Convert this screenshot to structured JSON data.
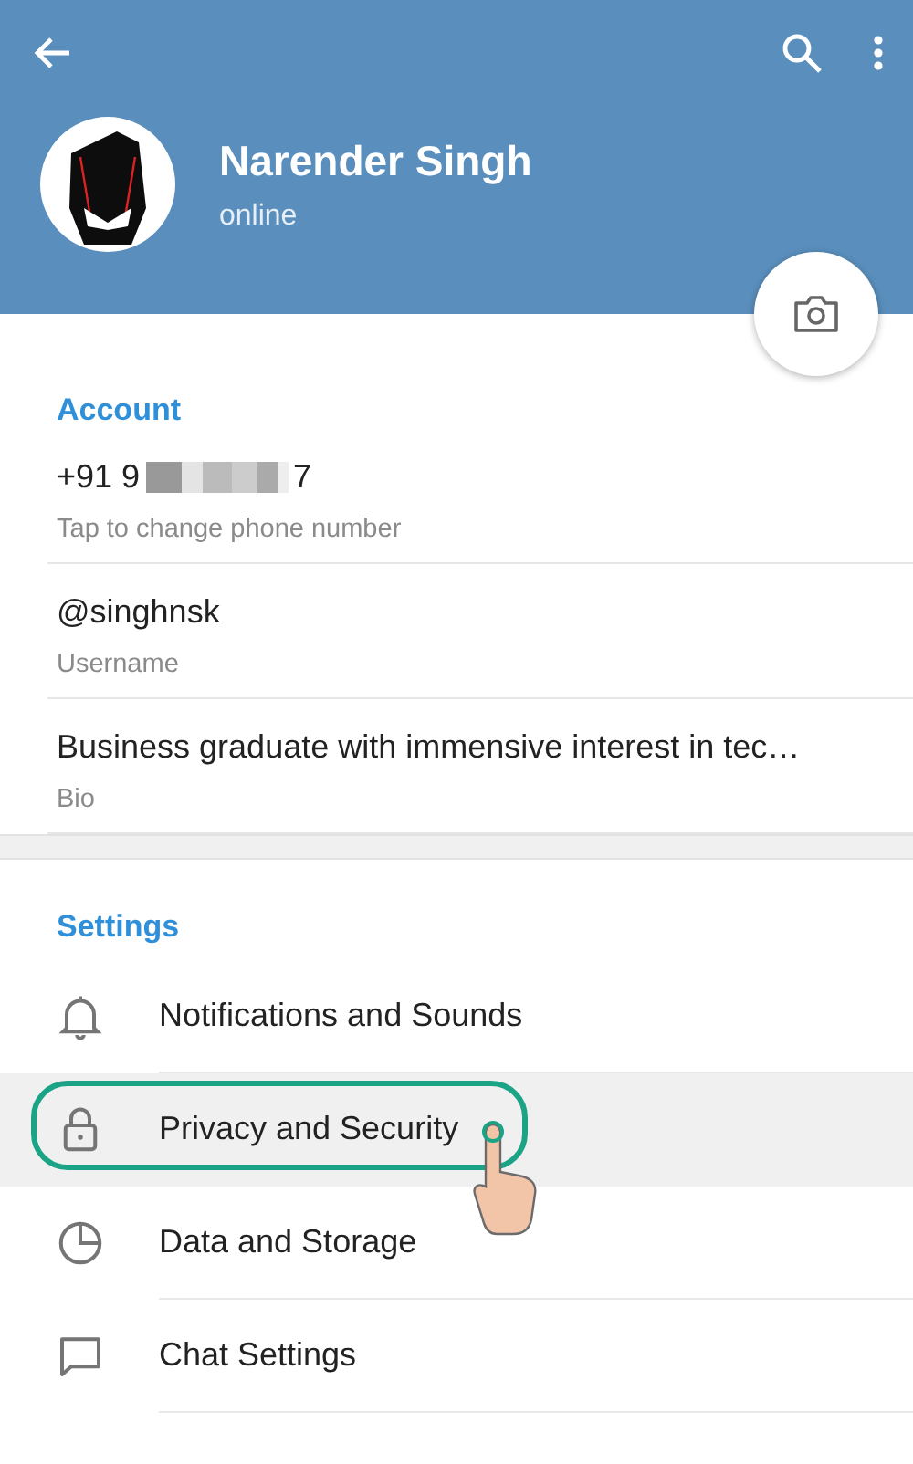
{
  "profile": {
    "name": "Narender Singh",
    "status": "online"
  },
  "account": {
    "title": "Account",
    "rows": [
      {
        "kind": "phone",
        "prefix": "+91 9",
        "suffix": "7",
        "hint": "Tap to change phone number"
      },
      {
        "kind": "text",
        "value": "@singhnsk",
        "hint": "Username"
      },
      {
        "kind": "text",
        "value": "Business graduate with immensive interest in tec…",
        "hint": "Bio"
      }
    ]
  },
  "settings": {
    "title": "Settings",
    "items": [
      {
        "label": "Notifications and Sounds",
        "selected": false,
        "callout": false
      },
      {
        "label": "Privacy and Security",
        "selected": true,
        "callout": true
      },
      {
        "label": "Data and Storage",
        "selected": false,
        "callout": false
      },
      {
        "label": "Chat Settings",
        "selected": false,
        "callout": false
      }
    ]
  }
}
